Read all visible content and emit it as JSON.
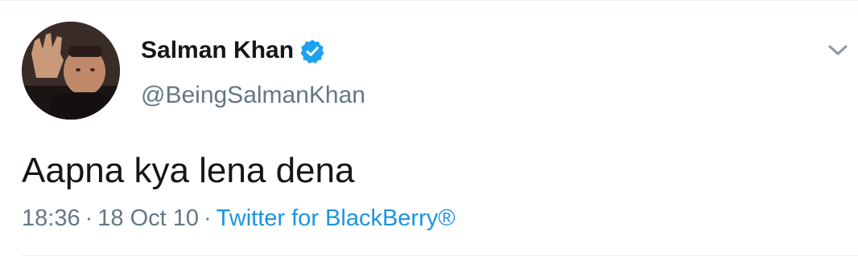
{
  "tweet": {
    "author": {
      "display_name": "Salman Khan",
      "handle": "@BeingSalmanKhan",
      "verified": true,
      "avatar_icon": "profile-photo"
    },
    "text": "Aapna kya lena dena",
    "meta": {
      "time": "18:36",
      "separator": "·",
      "date": "18 Oct 10",
      "source": "Twitter for BlackBerry®"
    },
    "menu_icon": "chevron-down-icon"
  },
  "colors": {
    "primary_text": "#14171a",
    "secondary_text": "#657786",
    "link": "#1b95e0",
    "verified_badge": "#1da1f2",
    "divider": "#e6ecf0"
  }
}
